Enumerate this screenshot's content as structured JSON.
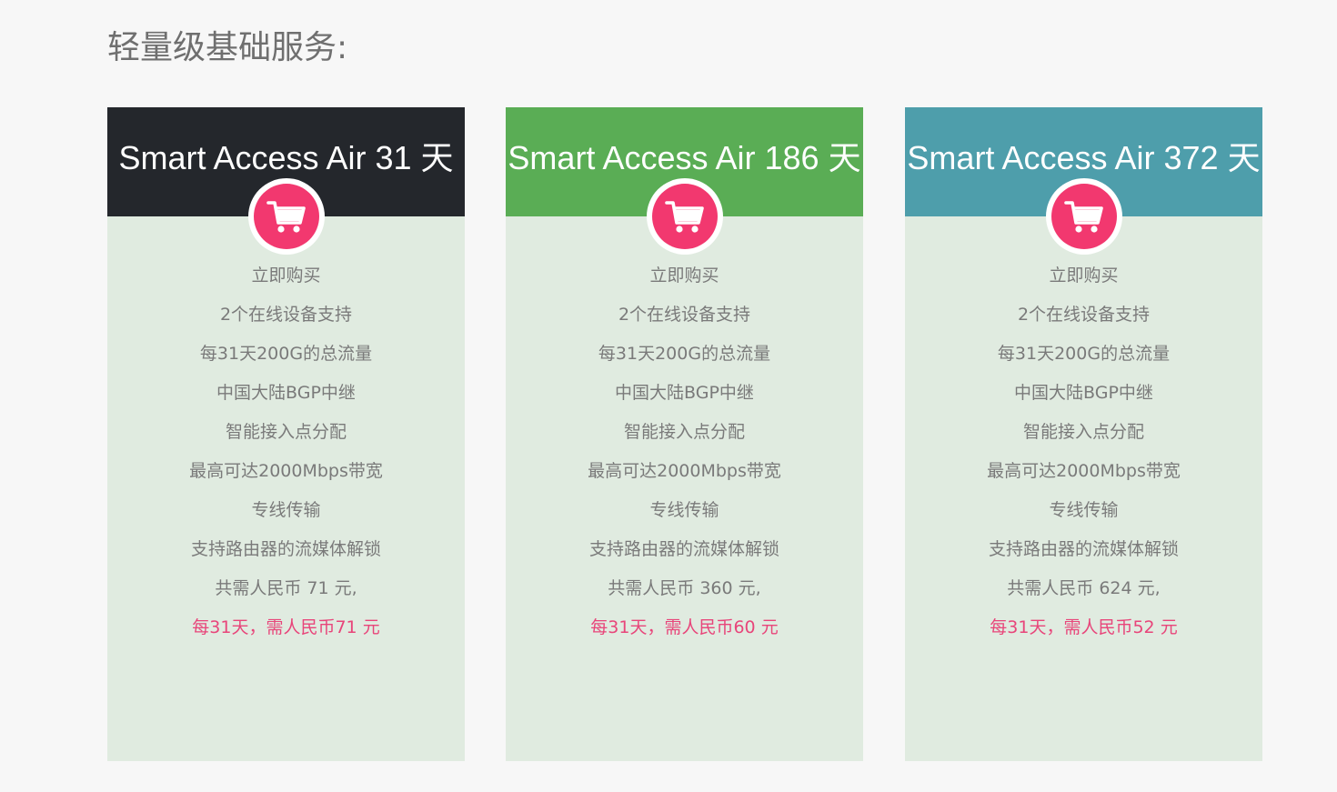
{
  "section": {
    "title": "轻量级基础服务:"
  },
  "colors": {
    "card_body": "#e0ebe0",
    "cart_accent": "#f2386f",
    "price_highlight": "#e8457a"
  },
  "plans": [
    {
      "title": "Smart Access Air 31 天",
      "header_color": "#24272c",
      "icon": "shopping-cart-icon",
      "buy_label": "立即购买",
      "features": [
        "2个在线设备支持",
        "每31天200G的总流量",
        "中国大陆BGP中继",
        "智能接入点分配",
        "最高可达2000Mbps带宽",
        "专线传输",
        "支持路由器的流媒体解锁",
        "共需人民币 71 元,"
      ],
      "price_note": "每31天，需人民币71 元"
    },
    {
      "title": "Smart Access Air 186 天",
      "header_color": "#5aad55",
      "icon": "shopping-cart-icon",
      "buy_label": "立即购买",
      "features": [
        "2个在线设备支持",
        "每31天200G的总流量",
        "中国大陆BGP中继",
        "智能接入点分配",
        "最高可达2000Mbps带宽",
        "专线传输",
        "支持路由器的流媒体解锁",
        "共需人民币 360 元,"
      ],
      "price_note": "每31天，需人民币60 元"
    },
    {
      "title": "Smart Access Air 372 天",
      "header_color": "#4e9eab",
      "icon": "shopping-cart-icon",
      "buy_label": "立即购买",
      "features": [
        "2个在线设备支持",
        "每31天200G的总流量",
        "中国大陆BGP中继",
        "智能接入点分配",
        "最高可达2000Mbps带宽",
        "专线传输",
        "支持路由器的流媒体解锁",
        "共需人民币 624 元,"
      ],
      "price_note": "每31天，需人民币52 元"
    }
  ]
}
